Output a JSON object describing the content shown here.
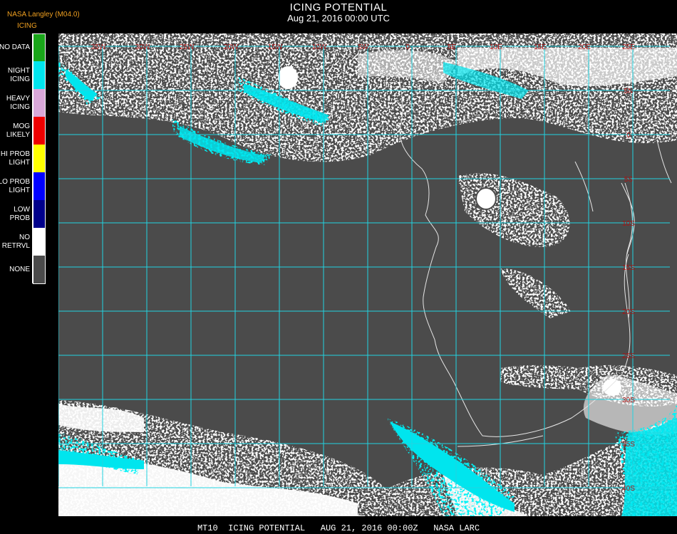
{
  "header": {
    "title": "ICING POTENTIAL",
    "datetime": "Aug 21, 2016 00:00 UTC",
    "credit": "NASA Langley (M04.0)",
    "product": "ICING"
  },
  "legend": [
    {
      "label": "NO DATA",
      "color": "#1aa61a"
    },
    {
      "label": "NIGHT\nICING",
      "color": "#00e5ee"
    },
    {
      "label": "HEAVY\nICING",
      "color": "#d9a8d9"
    },
    {
      "label": "MOG\nLIKELY",
      "color": "#ee0000"
    },
    {
      "label": "HI PROB\nLIGHT",
      "color": "#ffff00"
    },
    {
      "label": "LO PROB\nLIGHT",
      "color": "#0000ff"
    },
    {
      "label": "LOW\nPROB",
      "color": "#00008b"
    },
    {
      "label": "NO\nRETRVL",
      "color": "#ffffff"
    },
    {
      "label": "NONE",
      "color": "#4b4b4b"
    }
  ],
  "map": {
    "background_color": "#4b4b4b",
    "grid_color": "#22d3e0",
    "longitude_labels": [
      "35W",
      "30W",
      "25W",
      "20W",
      "15W",
      "10W",
      "5W",
      "0",
      "5E",
      "10E",
      "15E",
      "20E",
      "25E"
    ],
    "latitude_labels": [
      "5N",
      "0",
      "5S",
      "10S",
      "15S",
      "20S",
      "25S",
      "30S",
      "35S",
      "40S"
    ]
  },
  "footer": {
    "text": "MT10  ICING POTENTIAL   AUG 21, 2016 00:00Z   NASA LARC"
  }
}
